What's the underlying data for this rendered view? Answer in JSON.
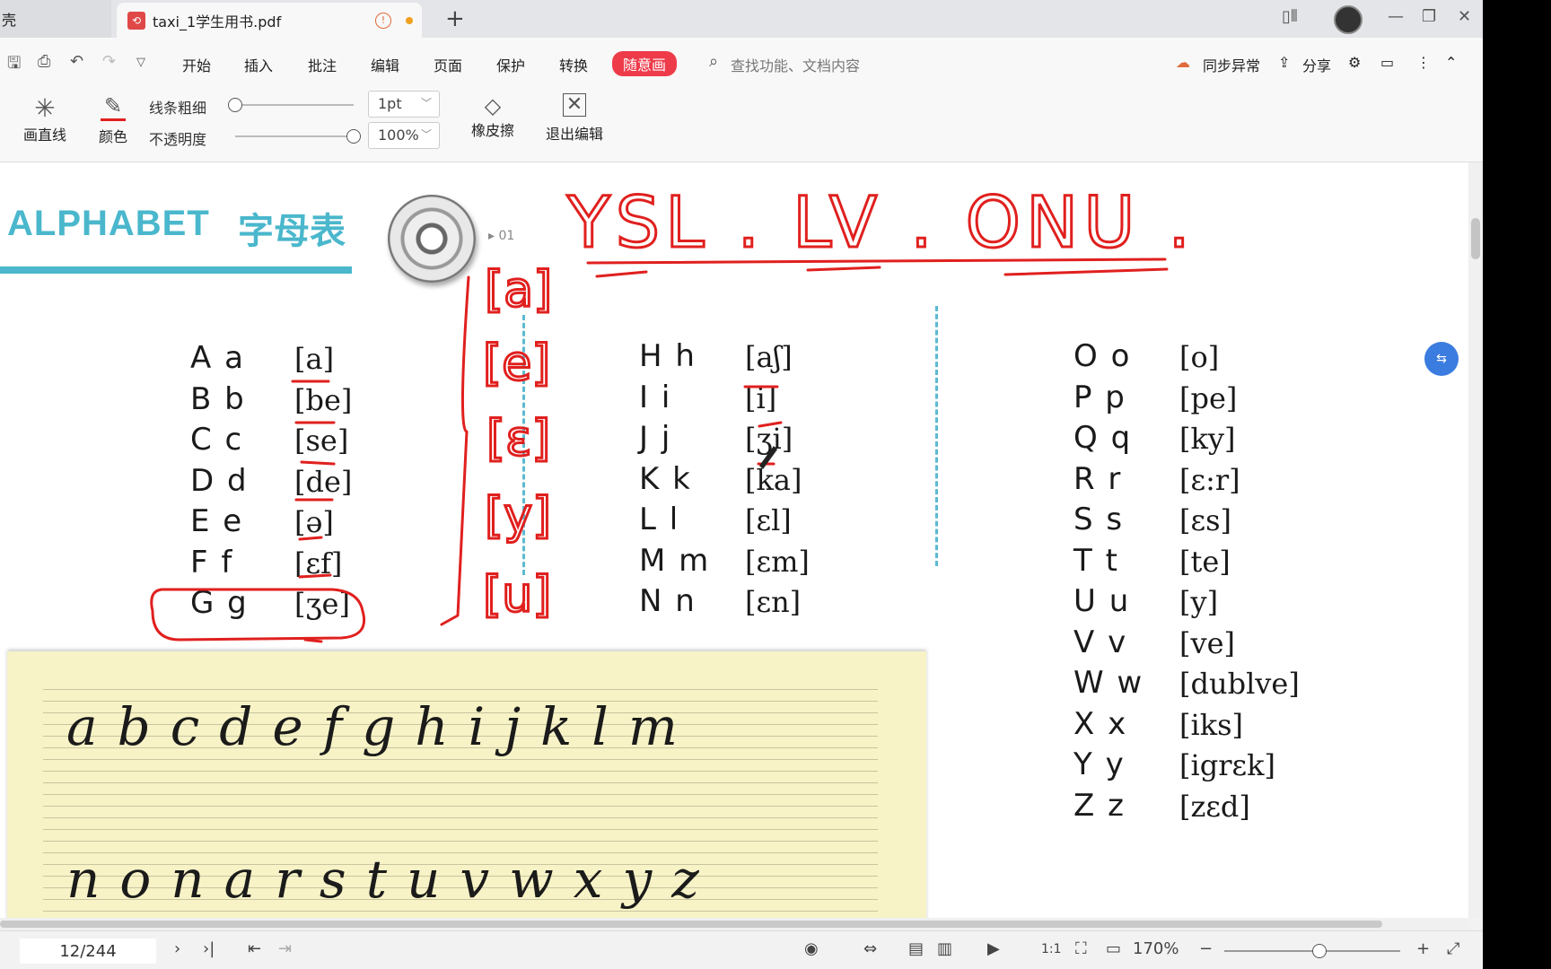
{
  "tabs": {
    "prev_tab": "壳",
    "active_tab": "taxi_1学生用书.pdf",
    "new_tab": "+"
  },
  "menu": {
    "items": [
      "开始",
      "插入",
      "批注",
      "编辑",
      "页面",
      "保护",
      "转换"
    ],
    "active_item": "随意画",
    "search_placeholder": "查找功能、文档内容",
    "sync": "同步异常",
    "share": "分享"
  },
  "ribbon": {
    "draw_line": "画直线",
    "color": "颜色",
    "line_thickness_label": "线条粗细",
    "line_thickness_value": "1pt",
    "opacity_label": "不透明度",
    "opacity_value": "100%",
    "eraser": "橡皮擦",
    "exit_edit": "退出编辑",
    "line_thickness_level": 0.0,
    "opacity_level": 1.0
  },
  "document": {
    "heading_en": "ALPHABET",
    "heading_cn": "字母表",
    "track_no": "01",
    "col1": [
      {
        "letter": "A a",
        "phon": "[a]"
      },
      {
        "letter": "B b",
        "phon": "[be]"
      },
      {
        "letter": "C c",
        "phon": "[se]"
      },
      {
        "letter": "D d",
        "phon": "[de]"
      },
      {
        "letter": "E e",
        "phon": "[ə]"
      },
      {
        "letter": "F f",
        "phon": "[ɛf]"
      },
      {
        "letter": "G g",
        "phon": "[ʒe]"
      }
    ],
    "col2": [
      {
        "letter": "H h",
        "phon": "[aʃ]"
      },
      {
        "letter": "I i",
        "phon": "[i]"
      },
      {
        "letter": "J j",
        "phon": "[ʒi]"
      },
      {
        "letter": "K k",
        "phon": "[ka]"
      },
      {
        "letter": "L l",
        "phon": "[ɛl]"
      },
      {
        "letter": "M m",
        "phon": "[ɛm]"
      },
      {
        "letter": "N n",
        "phon": "[ɛn]"
      }
    ],
    "col3": [
      {
        "letter": "O o",
        "phon": "[o]"
      },
      {
        "letter": "P p",
        "phon": "[pe]"
      },
      {
        "letter": "Q q",
        "phon": "[ky]"
      },
      {
        "letter": "R r",
        "phon": "[ɛ:r]"
      },
      {
        "letter": "S s",
        "phon": "[ɛs]"
      },
      {
        "letter": "T t",
        "phon": "[te]"
      },
      {
        "letter": "U u",
        "phon": "[y]"
      },
      {
        "letter": "V v",
        "phon": "[ve]"
      },
      {
        "letter": "W w",
        "phon": "[dublve]"
      },
      {
        "letter": "X x",
        "phon": "[iks]"
      },
      {
        "letter": "Y y",
        "phon": "[igrɛk]"
      },
      {
        "letter": "Z z",
        "phon": "[zɛd]"
      }
    ],
    "cursive_row1": "abcdefghijklm",
    "cursive_row2": "nonarstuvwxyz",
    "handwriting_top": "YSL . LV .   ONU .",
    "handwriting_vowels": [
      "[a]",
      "[e]",
      "[ɛ]",
      "[y]",
      "[u]"
    ]
  },
  "status": {
    "page": "12/244",
    "zoom": "170%"
  },
  "colors": {
    "accent_red": "#ee3b4a",
    "heading_teal": "#4ab7cc",
    "ink_red": "#e0201e",
    "button_blue": "#3b7ce0"
  }
}
